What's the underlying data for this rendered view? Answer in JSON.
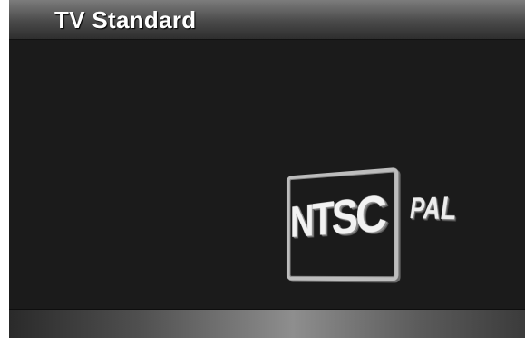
{
  "header": {
    "title": "TV Standard"
  },
  "options": [
    {
      "label": "NTSC",
      "selected": true
    },
    {
      "label": "PAL",
      "selected": false
    }
  ],
  "colors": {
    "background": "#1b1b1b",
    "header_top": "#7c7c7c",
    "text": "#ffffff",
    "focus_border": "#bdbdbd"
  }
}
